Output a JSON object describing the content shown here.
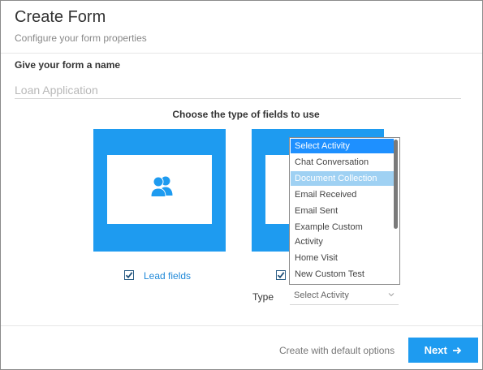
{
  "header": {
    "title": "Create Form",
    "subtitle": "Configure your form properties"
  },
  "name_section": {
    "label": "Give your form a name",
    "placeholder": "Loan Application"
  },
  "fields_section": {
    "label": "Choose the type of fields to use",
    "lead_option": {
      "label": "Lead fields",
      "checked": true,
      "icon": "users-icon"
    },
    "activity_option": {
      "checked": true,
      "type_label": "Type",
      "selected": "Select Activity"
    }
  },
  "dropdown": {
    "options": [
      "Select Activity",
      "Chat Conversation",
      "Document Collection",
      "Email Received",
      "Email Sent",
      "Example Custom Activity",
      "Home Visit",
      "New Custom Test"
    ],
    "selected_index": 0,
    "hover_index": 2
  },
  "footer": {
    "default_link": "Create with default options",
    "next_label": "Next",
    "next_icon": "arrow-right-icon"
  },
  "colors": {
    "accent": "#1e9bf0",
    "link": "#1e88d8"
  }
}
